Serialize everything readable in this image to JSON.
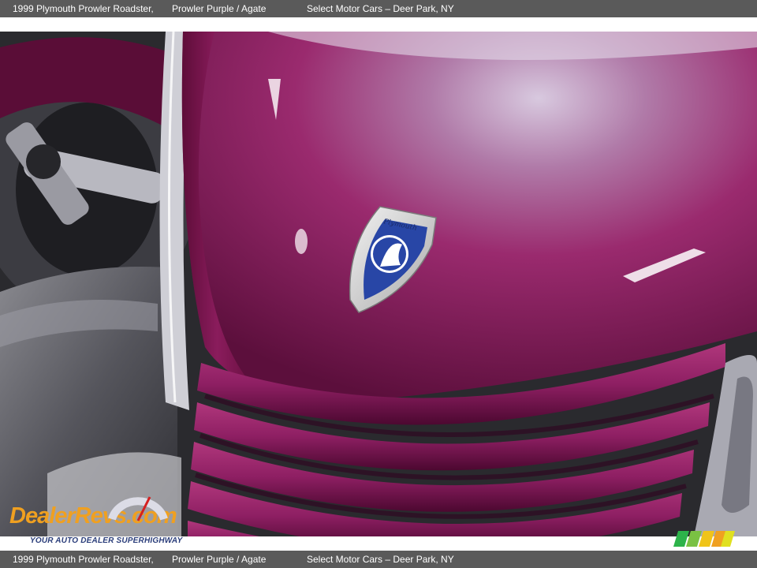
{
  "caption": {
    "title": "1999 Plymouth Prowler Roadster,",
    "color": "Prowler Purple / Agate",
    "dealer": "Select Motor Cars – Deer Park, NY"
  },
  "photo": {
    "paint_color": "#8e1f63",
    "highlight_color": "#c8b8d6",
    "badge_text": "Plymouth"
  },
  "watermark": {
    "brand": "DealerRevs.com",
    "tagline": "YOUR AUTO DEALER SUPERHIGHWAY",
    "colors": {
      "orange": "#f0a020",
      "blue": "#1c5aa8"
    }
  }
}
